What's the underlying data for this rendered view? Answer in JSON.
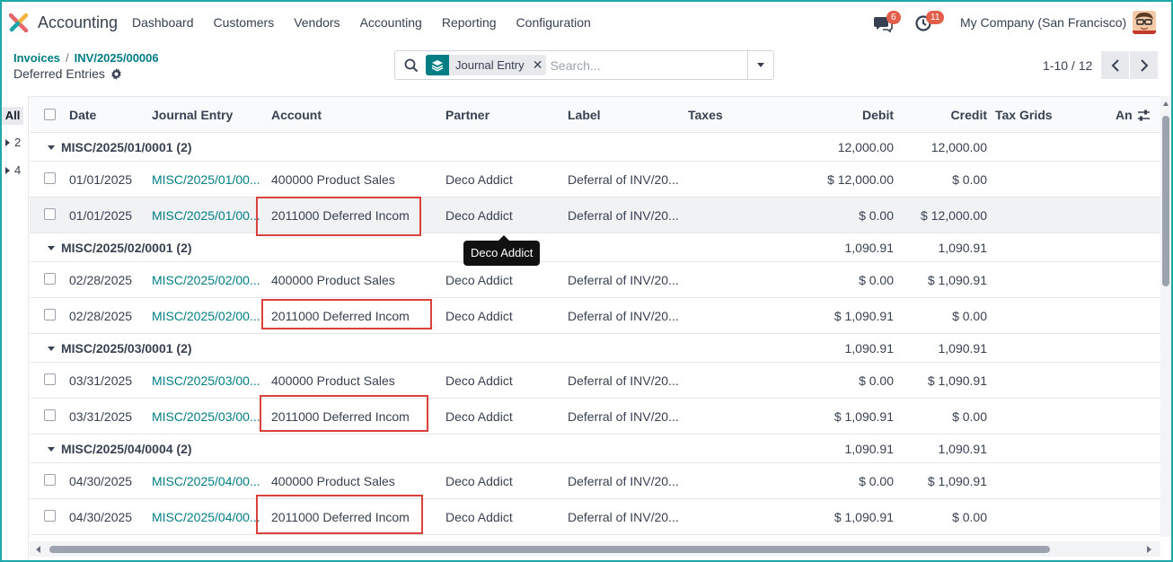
{
  "navbar": {
    "app_name": "Accounting",
    "menu": [
      "Dashboard",
      "Customers",
      "Vendors",
      "Accounting",
      "Reporting",
      "Configuration"
    ],
    "messages_badge": "6",
    "activity_badge": "11",
    "company": "My Company (San Francisco)"
  },
  "breadcrumb": {
    "items": [
      "Invoices",
      "INV/2025/00006"
    ],
    "current": "Deferred Entries"
  },
  "search": {
    "facet_label": "Journal Entry",
    "placeholder": "Search..."
  },
  "pager": {
    "text": "1-10 / 12"
  },
  "left_panel": {
    "all_label": "All",
    "groups": [
      "2",
      "4"
    ]
  },
  "columns": [
    "Date",
    "Journal Entry",
    "Account",
    "Partner",
    "Label",
    "Taxes",
    "Debit",
    "Credit",
    "Tax Grids",
    "An"
  ],
  "groups": [
    {
      "title": "MISC/2025/01/0001 (2)",
      "debit": "12,000.00",
      "credit": "12,000.00",
      "rows": [
        {
          "date": "01/01/2025",
          "entry": "MISC/2025/01/00...",
          "account": "400000 Product Sales",
          "partner": "Deco Addict",
          "label": "Deferral of INV/20...",
          "debit": "$ 12,000.00",
          "credit": "$ 0.00"
        },
        {
          "date": "01/01/2025",
          "entry": "MISC/2025/01/00...",
          "account": "2011000 Deferred Incom",
          "partner": "Deco Addict",
          "label": "Deferral of INV/20...",
          "debit": "$ 0.00",
          "credit": "$ 12,000.00"
        }
      ]
    },
    {
      "title": "MISC/2025/02/0001 (2)",
      "debit": "1,090.91",
      "credit": "1,090.91",
      "rows": [
        {
          "date": "02/28/2025",
          "entry": "MISC/2025/02/00...",
          "account": "400000 Product Sales",
          "partner": "Deco Addict",
          "label": "Deferral of INV/20...",
          "debit": "$ 0.00",
          "credit": "$ 1,090.91"
        },
        {
          "date": "02/28/2025",
          "entry": "MISC/2025/02/00...",
          "account": "2011000 Deferred Incom",
          "partner": "Deco Addict",
          "label": "Deferral of INV/20...",
          "debit": "$ 1,090.91",
          "credit": "$ 0.00"
        }
      ]
    },
    {
      "title": "MISC/2025/03/0001 (2)",
      "debit": "1,090.91",
      "credit": "1,090.91",
      "rows": [
        {
          "date": "03/31/2025",
          "entry": "MISC/2025/03/00...",
          "account": "400000 Product Sales",
          "partner": "Deco Addict",
          "label": "Deferral of INV/20...",
          "debit": "$ 0.00",
          "credit": "$ 1,090.91"
        },
        {
          "date": "03/31/2025",
          "entry": "MISC/2025/03/00...",
          "account": "2011000 Deferred Incom",
          "partner": "Deco Addict",
          "label": "Deferral of INV/20...",
          "debit": "$ 1,090.91",
          "credit": "$ 0.00"
        }
      ]
    },
    {
      "title": "MISC/2025/04/0004 (2)",
      "debit": "1,090.91",
      "credit": "1,090.91",
      "rows": [
        {
          "date": "04/30/2025",
          "entry": "MISC/2025/04/00...",
          "account": "400000 Product Sales",
          "partner": "Deco Addict",
          "label": "Deferral of INV/20...",
          "debit": "$ 0.00",
          "credit": "$ 1,090.91"
        },
        {
          "date": "04/30/2025",
          "entry": "MISC/2025/04/00...",
          "account": "2011000 Deferred Incom",
          "partner": "Deco Addict",
          "label": "Deferral of INV/20...",
          "debit": "$ 1,090.91",
          "credit": "$ 0.00"
        }
      ]
    }
  ],
  "tooltip": {
    "text": "Deco Addict"
  },
  "colors": {
    "accent": "#017e84",
    "highlight": "#d9413a",
    "badge": "#e25d4a"
  }
}
